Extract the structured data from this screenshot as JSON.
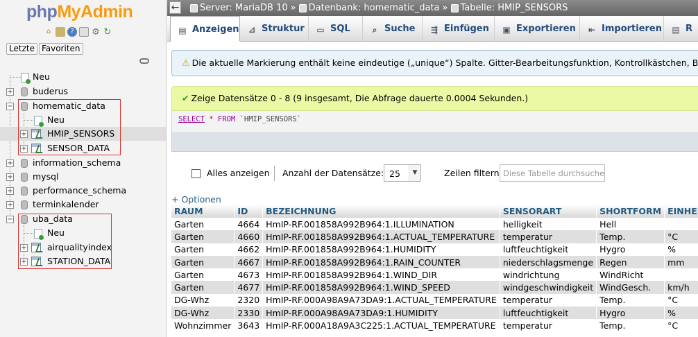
{
  "nav": {
    "logo_php": "php",
    "logo_myadmin": "MyAdmin",
    "tabs": [
      "Letzte",
      "Favoriten"
    ],
    "tree": {
      "neu": "Neu",
      "db1": "buderus",
      "db2": "homematic_data",
      "db2_new": "Neu",
      "db2_t1": "HMIP_SENSORS",
      "db2_t2": "SENSOR_DATA",
      "db3": "information_schema",
      "db4": "mysql",
      "db5": "performance_schema",
      "db6": "terminkalender",
      "db7": "uba_data",
      "db7_new": "Neu",
      "db7_t1": "airqualityindex",
      "db7_t2": "STATION_DATA"
    }
  },
  "breadcrumb": {
    "server": "Server: MariaDB 10",
    "database": "Datenbank: homematic_data",
    "table": "Tabelle: HMIP_SENSORS",
    "separator": "»"
  },
  "tabs": {
    "anzeigen": "Anzeigen",
    "struktur": "Struktur",
    "sql": "SQL",
    "suche": "Suche",
    "einfuegen": "Einfügen",
    "exportieren": "Exportieren",
    "importieren": "Importieren",
    "more": "R"
  },
  "notice": "Die aktuelle Markierung enthält keine eindeutige („unique“) Spalte. Gitter-Bearbeitungsfunktion, Kontrollkästchen, Bearbeiten, Ko",
  "success": "Zeige Datensätze 0 - 8 (9 insgesamt, Die Abfrage dauerte 0.0004 Sekunden.)",
  "sql": {
    "select": "SELECT",
    "star": "*",
    "from": "FROM",
    "table": "`HMIP_SENSORS`"
  },
  "controls": {
    "show_all": "Alles anzeigen",
    "rows_label": "Anzahl der Datensätze:",
    "rows_value": "25",
    "filter_label": "Zeilen filtern:",
    "filter_placeholder": "Diese Tabelle durchsuchen"
  },
  "options_link": "+ Optionen",
  "grid": {
    "columns": [
      "RAUM",
      "ID",
      "BEZEICHNUNG",
      "SENSORART",
      "SHORTFORM",
      "EINHEIT"
    ],
    "rows": [
      [
        "Garten",
        "4664",
        "HmIP-RF.001858A992B964:1.ILLUMINATION",
        "helligkeit",
        "Hell",
        ""
      ],
      [
        "Garten",
        "4660",
        "HmIP-RF.001858A992B964:1.ACTUAL_TEMPERATURE",
        "temperatur",
        "Temp.",
        "°C"
      ],
      [
        "Garten",
        "4662",
        "HmIP-RF.001858A992B964:1.HUMIDITY",
        "luftfeuchtigkeit",
        "Hygro",
        "%"
      ],
      [
        "Garten",
        "4667",
        "HmIP-RF.001858A992B964:1.RAIN_COUNTER",
        "niederschlagsmenge",
        "Regen",
        "mm"
      ],
      [
        "Garten",
        "4673",
        "HmIP-RF.001858A992B964:1.WIND_DIR",
        "windrichtung",
        "WindRicht",
        ""
      ],
      [
        "Garten",
        "4677",
        "HmIP-RF.001858A992B964:1.WIND_SPEED",
        "windgeschwindigkeit",
        "WindGesch.",
        "km/h"
      ],
      [
        "DG-Whz",
        "2320",
        "HmIP-RF.000A98A9A73DA9:1.ACTUAL_TEMPERATURE",
        "temperatur",
        "Temp.",
        "°C"
      ],
      [
        "DG-Whz",
        "2330",
        "HmIP-RF.000A98A9A73DA9:1.HUMIDITY",
        "luftfeuchtigkeit",
        "Hygro",
        "%"
      ],
      [
        "Wohnzimmer",
        "3643",
        "HmIP-RF.000A18A9A3C225:1.ACTUAL_TEMPERATURE",
        "temperatur",
        "Temp.",
        "°C"
      ]
    ]
  },
  "colors": {
    "accent": "#235a81",
    "highlight_box": "#d8312d",
    "success_bg": "#ebf8a4",
    "notice_bg": "#eaf2fa"
  }
}
